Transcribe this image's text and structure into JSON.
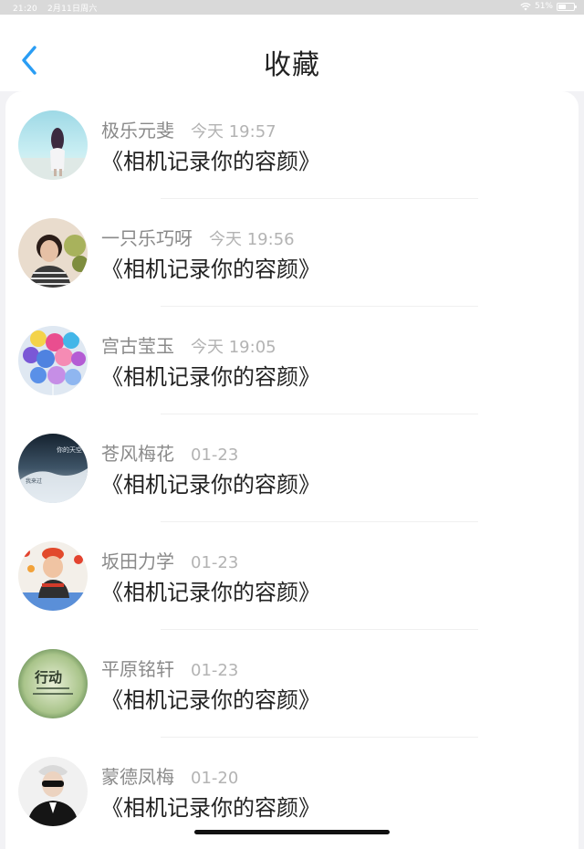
{
  "status_bar": {
    "time": "21:20",
    "date": "2月11日周六",
    "battery": "51%",
    "battery_level": 0.51,
    "wifi_icon": "wifi-icon",
    "battery_icon": "battery-icon"
  },
  "header": {
    "title": "收藏",
    "back_icon": "chevron-left-icon",
    "accent_color": "#2a9df4"
  },
  "items": [
    {
      "name": "极乐元斐",
      "time": "今天 19:57",
      "message": "《相机记录你的容颜》"
    },
    {
      "name": "一只乐巧呀",
      "time": "今天 19:56",
      "message": "《相机记录你的容颜》"
    },
    {
      "name": "宫古莹玉",
      "time": "今天 19:05",
      "message": "《相机记录你的容颜》"
    },
    {
      "name": "苍风梅花",
      "time": "01-23",
      "message": "《相机记录你的容颜》",
      "avatar_text": [
        "你的天空",
        "我来过"
      ]
    },
    {
      "name": "坂田力学",
      "time": "01-23",
      "message": "《相机记录你的容颜》"
    },
    {
      "name": "平原铭轩",
      "time": "01-23",
      "message": "《相机记录你的容颜》",
      "avatar_text": [
        "行动"
      ]
    },
    {
      "name": "蒙德凤梅",
      "time": "01-20",
      "message": "《相机记录你的容颜》"
    }
  ]
}
